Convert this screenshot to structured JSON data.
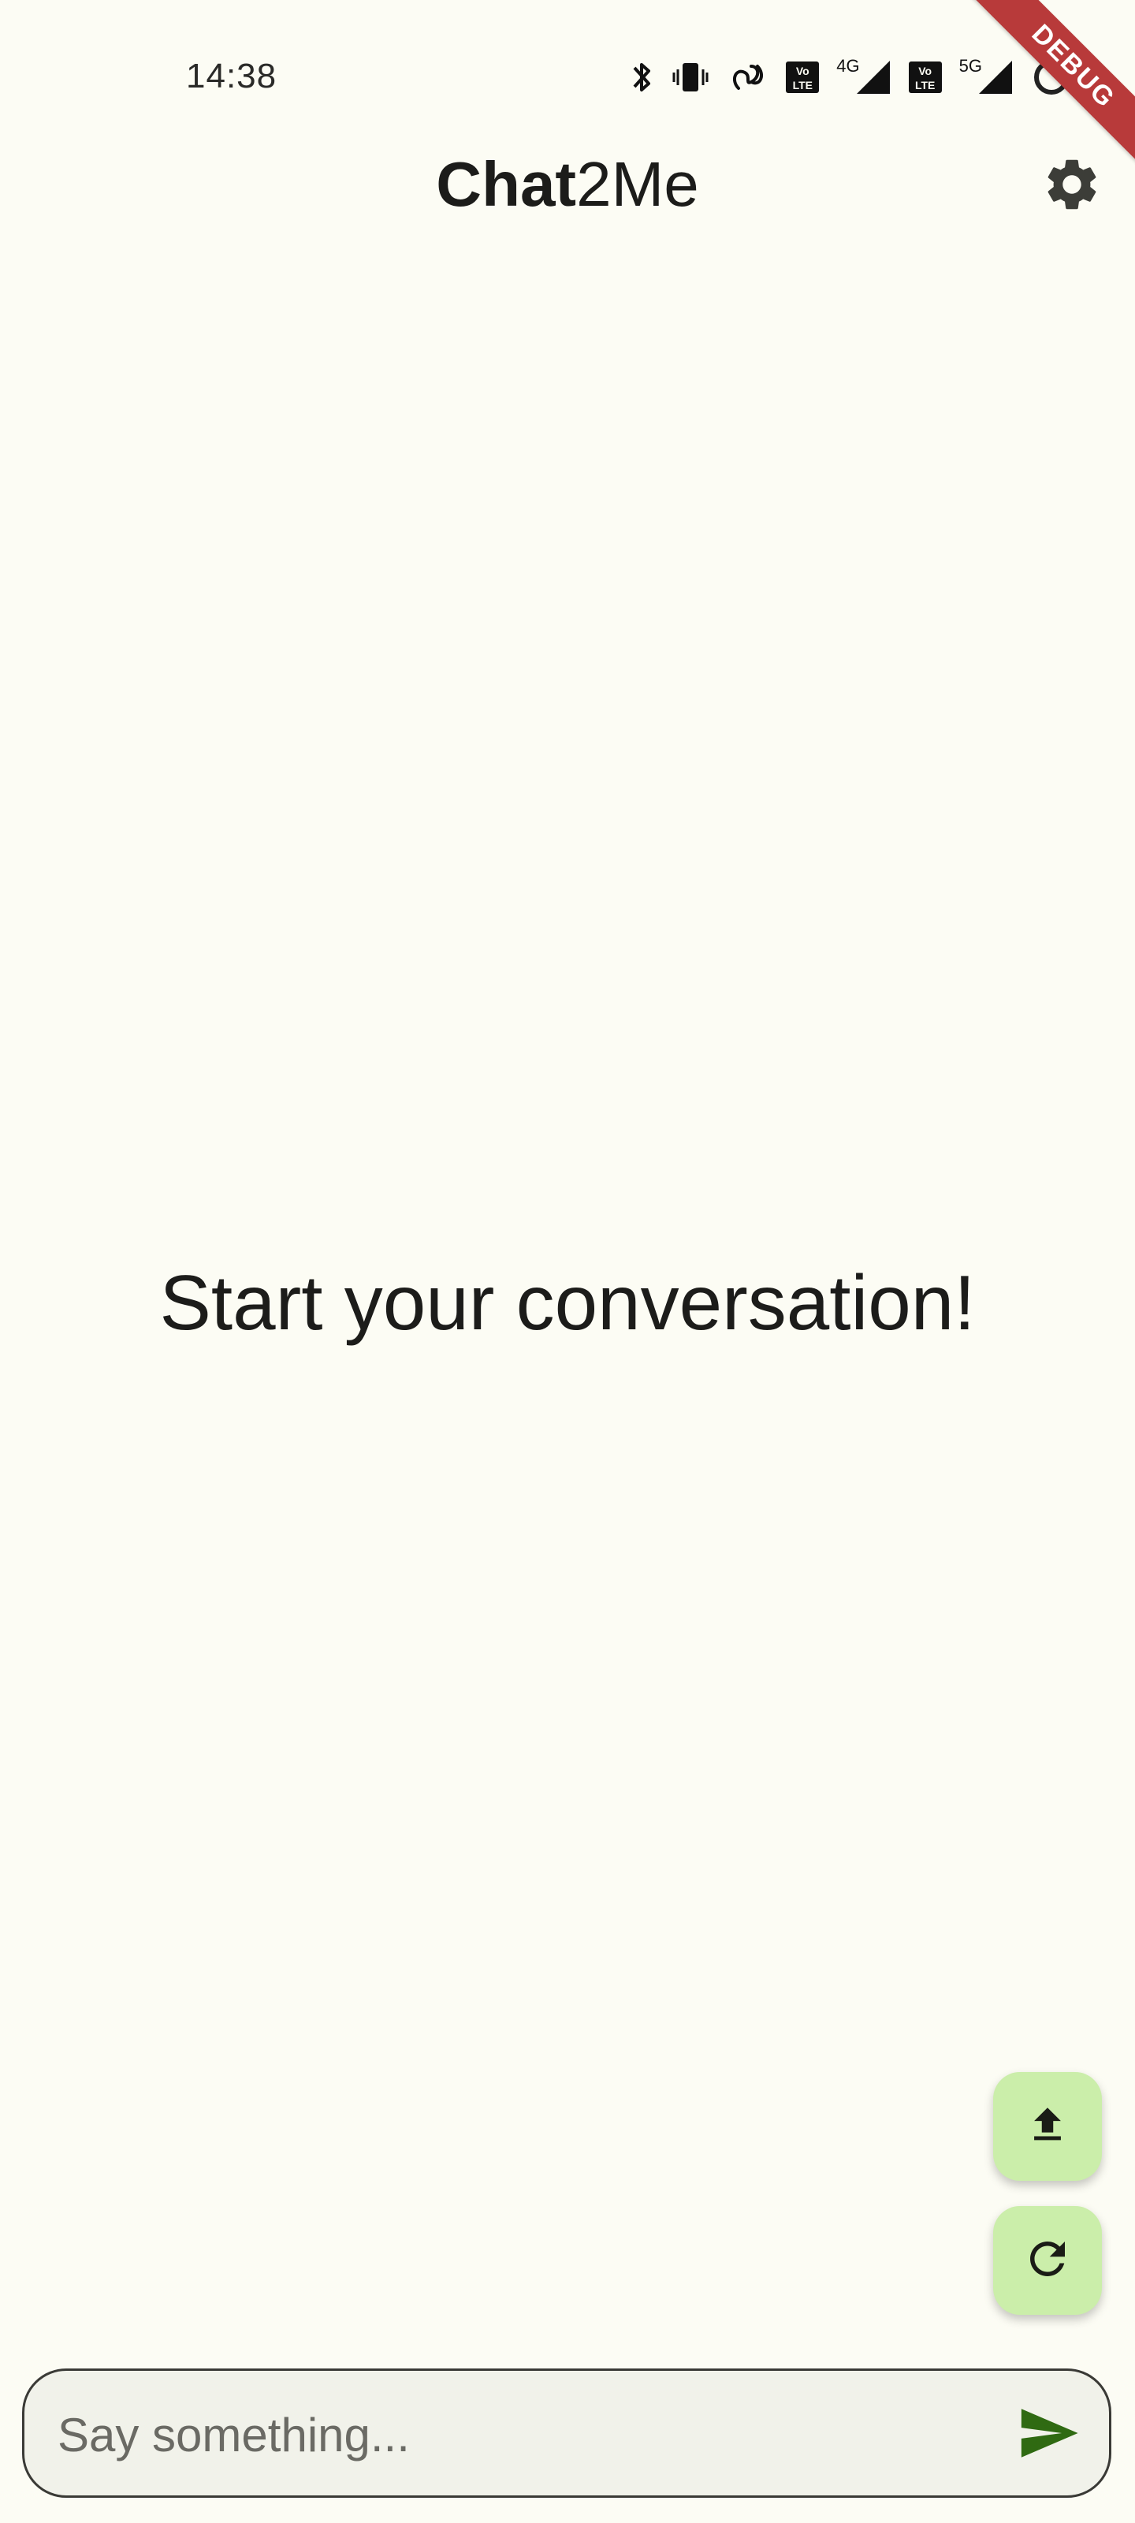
{
  "status_bar": {
    "time": "14:38",
    "network_4g": "4G",
    "network_5g": "5G",
    "lte_label": "Vo LTE",
    "icons": [
      "bluetooth-icon",
      "vibrate-icon",
      "hotspot-link-icon",
      "volte-icon",
      "signal-4g-icon",
      "volte-icon",
      "signal-5g-icon",
      "loading-ring-icon"
    ]
  },
  "debug_banner": "DEBUG",
  "app_bar": {
    "title_bold": "Chat",
    "title_regular": "2Me",
    "settings_icon": "gear-icon"
  },
  "main": {
    "empty_message": "Start your conversation!"
  },
  "fabs": {
    "upload_icon": "upload-icon",
    "refresh_icon": "refresh-icon"
  },
  "composer": {
    "placeholder": "Say something...",
    "value": "",
    "send_icon": "send-icon"
  },
  "colors": {
    "background": "#FCFCF4",
    "fab": "#CBEEAA",
    "send_accent": "#2F6A12",
    "debug_ribbon": "#B83A3A"
  }
}
